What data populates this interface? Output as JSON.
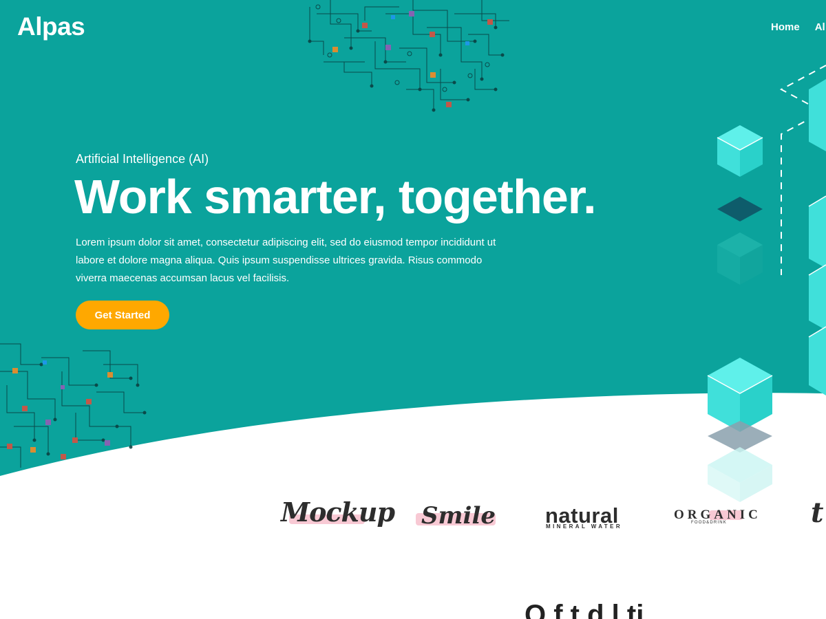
{
  "brand": {
    "logo": "Alpas"
  },
  "nav": {
    "items": [
      "Home",
      "Al"
    ]
  },
  "hero": {
    "eyebrow": "Artificial Intelligence (AI)",
    "headline": "Work smarter, together.",
    "lead": "Lorem ipsum dolor sit amet, consectetur adipiscing elit, sed do eiusmod tempor incididunt ut labore et dolore magna aliqua. Quis ipsum suspendisse ultrices gravida. Risus commodo viverra maecenas accumsan lacus vel facilisis.",
    "cta_label": "Get Started"
  },
  "logos": {
    "mockup": "Mockup",
    "smile": "Smile",
    "natural": "natural",
    "natural_sub": "MINERAL WATER",
    "organic": "ORGANIC",
    "organic_sub": "FOOD&DRINK",
    "partial": "t"
  },
  "section": {
    "title_partial": "O f t d l ti"
  },
  "colors": {
    "hero_bg": "#0ba39c",
    "cta": "#ffa800",
    "cube_light": "#40e0da",
    "cube_dark": "#0e5c6b",
    "accent_red": "#e24b3b",
    "accent_orange": "#ff8a1f",
    "accent_purple": "#9b59b6",
    "accent_blue": "#2196f3"
  },
  "icons": [
    "circuit-pattern-top",
    "circuit-pattern-left",
    "isometric-cubes",
    "dashed-connector-lines"
  ]
}
